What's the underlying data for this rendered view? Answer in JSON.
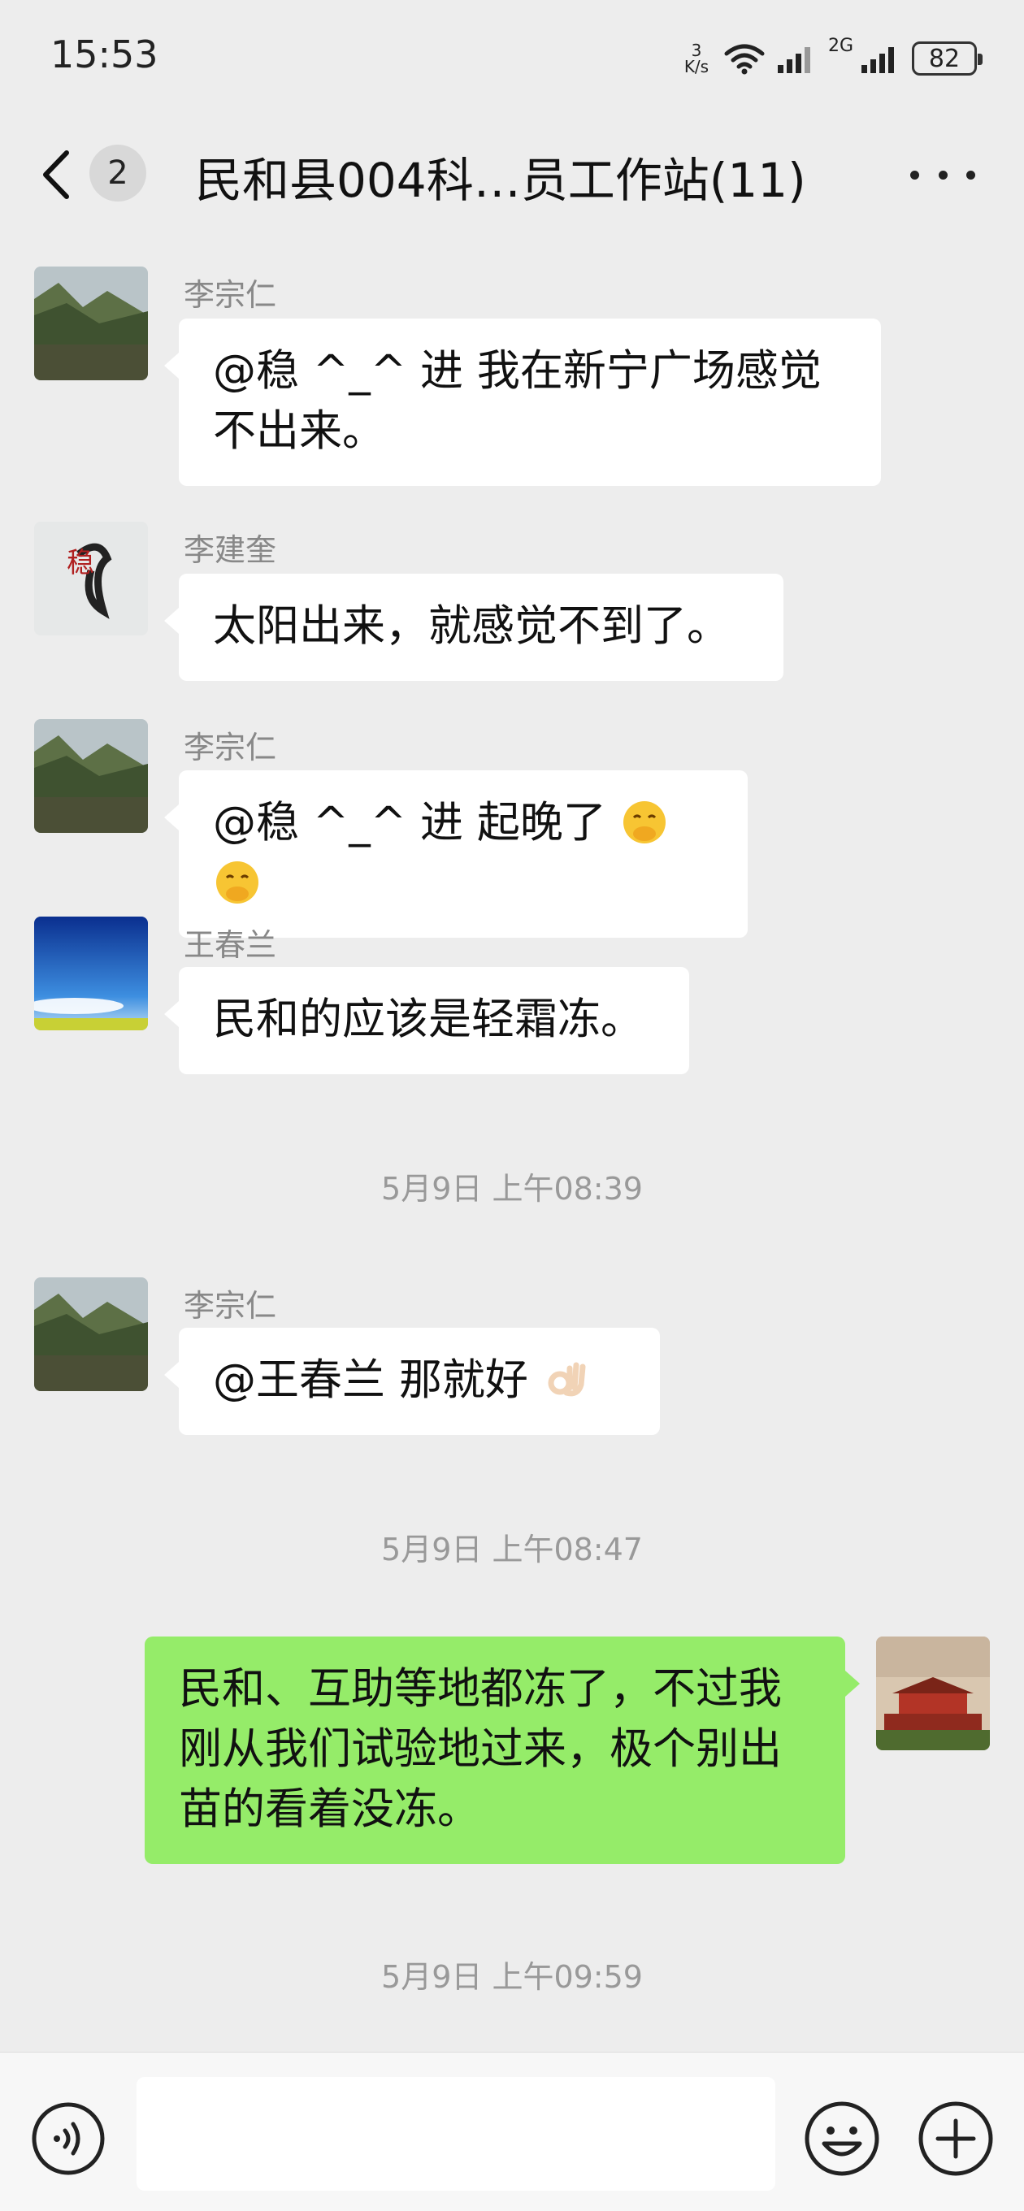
{
  "status_bar": {
    "time": "15:53",
    "net_speed_value": "3",
    "net_speed_unit": "K/s",
    "network_2g": "2G",
    "battery": "82"
  },
  "nav": {
    "badge_count": "2",
    "title": "民和县004科…员工作站(11)"
  },
  "messages": [
    {
      "sender": "李宗仁",
      "text": "@稳 ^_^ 进  我在新宁广场感觉不出来。",
      "avatar": "mountain-lake-avatar"
    },
    {
      "sender": "李建奎",
      "text": "太阳出来，就感觉不到了。",
      "avatar": "calligraphy-avatar"
    },
    {
      "sender": "李宗仁",
      "text": "@稳 ^_^ 进  起晚了",
      "emoji": "face-with-hand-over-mouth ×2",
      "avatar": "mountain-lake-avatar"
    },
    {
      "sender": "王春兰",
      "text": "民和的应该是轻霜冻。",
      "avatar": "blue-sky-avatar"
    },
    {
      "sender": "李宗仁",
      "text": "@王春兰  那就好",
      "emoji": "ok-hand",
      "avatar": "mountain-lake-avatar"
    },
    {
      "sender": "",
      "text": "民和、互助等地都冻了，不过我刚从我们试验地过来，极个别出苗的看着没冻。",
      "avatar": "tiananmen-avatar",
      "mine": true
    }
  ],
  "timestamps": [
    "5月9日 上午08:39",
    "5月9日 上午08:47",
    "5月9日 上午09:59"
  ],
  "colors": {
    "background": "#ededed",
    "my_bubble": "#95ec69",
    "other_bubble": "#ffffff"
  }
}
